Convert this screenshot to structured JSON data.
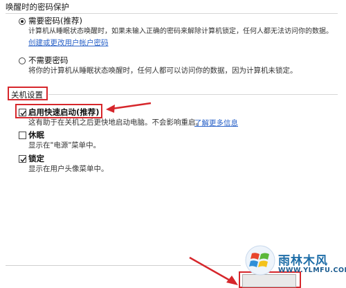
{
  "wake_password": {
    "heading": "唤醒时的密码保护",
    "option_require": {
      "label": "需要密码(推荐)",
      "desc_line1": "计算机从睡眠状态唤醒时，如果未输入正确的密码来解除计算机锁定，任何人都无法访问你的数据。",
      "link": "创建或更改用户帐户密码",
      "selected": true
    },
    "option_norequire": {
      "label": "不需要密码",
      "desc": "将你的计算机从睡眠状态唤醒时，任何人都可以访问你的数据，因为计算机未锁定。",
      "selected": false
    }
  },
  "shutdown": {
    "heading": "关机设置",
    "fast_startup": {
      "label": "启用快速启动(推荐)",
      "desc": "这有助于在关机之后更快地启动电脑。不会影响重启。",
      "link": "了解更多信息",
      "checked": true
    },
    "hibernate": {
      "label": "休眠",
      "desc": "显示在\"电源\"菜单中。",
      "checked": false
    },
    "lock": {
      "label": "锁定",
      "desc": "显示在用户头像菜单中。",
      "checked": true
    }
  },
  "watermark": {
    "brand": "雨林木风",
    "url": "WWW.YLMFU.COM"
  },
  "colors": {
    "highlight_red": "#d6262b",
    "link_blue": "#2a62c8"
  }
}
